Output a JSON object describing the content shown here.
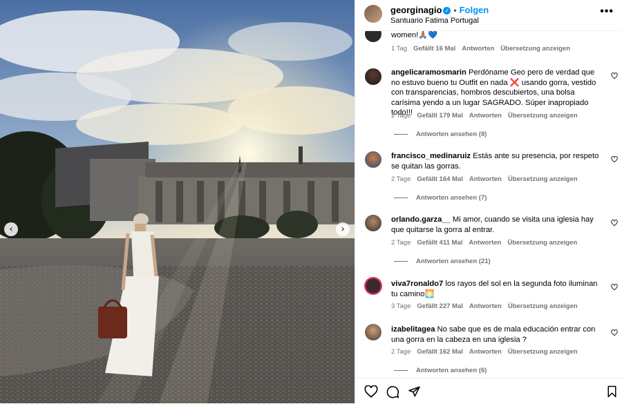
{
  "post": {
    "username": "georginagio",
    "separator": "•",
    "follow_label": "Folgen",
    "location": "Santuario Fatima Portugal",
    "more_label": "•••"
  },
  "carousel": {
    "prev_icon": "chevron-left-icon",
    "next_icon": "chevron-right-icon",
    "prev_glyph": "‹",
    "next_glyph": "›"
  },
  "comments": [
    {
      "username": "",
      "text": "women!🙏🏽💙",
      "time": "1 Tag",
      "likes": "Gefällt 16 Mal",
      "reply": "Antworten",
      "translate": "Übersetzung anzeigen",
      "view_replies": ""
    },
    {
      "username": "angelicaramosmarin",
      "text": "Perdóname Geo pero de verdad que no estuvo bueno tu Outfit en nada ❌ usando gorra, vestido con transparencias, hombros descubiertos, una bolsa carísima yendo a un lugar SAGRADO. Súper inapropiado todo!!!",
      "time": "2 Tage",
      "likes": "Gefällt 179 Mal",
      "reply": "Antworten",
      "translate": "Übersetzung anzeigen",
      "view_replies": "Antworten ansehen (8)"
    },
    {
      "username": "francisco_medinaruiz",
      "text": "Estás ante su presencia, por respeto se quitan las gorras.",
      "time": "2 Tage",
      "likes": "Gefällt 164 Mal",
      "reply": "Antworten",
      "translate": "Übersetzung anzeigen",
      "view_replies": "Antworten ansehen (7)"
    },
    {
      "username": "orlando.garza__",
      "text": "Mi amor, cuando se visita una iglesia hay que quitarse la gorra al entrar.",
      "time": "2 Tage",
      "likes": "Gefällt 411 Mal",
      "reply": "Antworten",
      "translate": "Übersetzung anzeigen",
      "view_replies": "Antworten ansehen (21)"
    },
    {
      "username": "viva7ronaldo7",
      "text": "los rayos del sol en la segunda foto iluminan tu camino🌅",
      "time": "3 Tage",
      "likes": "Gefällt 227 Mal",
      "reply": "Antworten",
      "translate": "Übersetzung anzeigen",
      "view_replies": ""
    },
    {
      "username": "izabelitagea",
      "text": "No sabe que es de mala educación entrar con una gorra en la cabeza en una iglesia ?",
      "time": "2 Tage",
      "likes": "Gefällt 162 Mal",
      "reply": "Antworten",
      "translate": "Übersetzung anzeigen",
      "view_replies": "Antworten ansehen (6)"
    }
  ],
  "actions": {
    "like_icon": "heart-icon",
    "comment_icon": "comment-icon",
    "share_icon": "send-icon",
    "save_icon": "bookmark-icon"
  },
  "colors": {
    "accent": "#0095f6",
    "secondary_text": "#737373"
  }
}
